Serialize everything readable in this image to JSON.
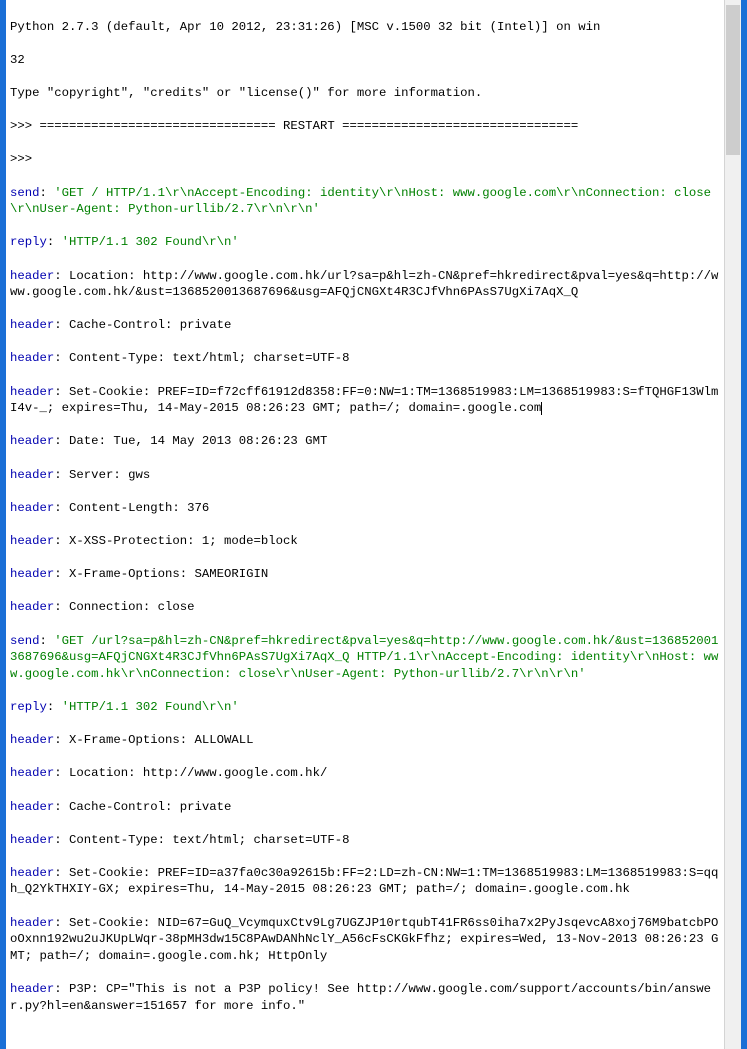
{
  "banner": {
    "line1": "Python 2.7.3 (default, Apr 10 2012, 23:31:26) [MSC v.1500 32 bit (Intel)] on win",
    "line2": "32",
    "typeinfo": "Type \"copyright\", \"credits\" or \"license()\" for more information.",
    "prompt1": ">>> ",
    "restart_bar": "================================ RESTART ================================",
    "prompt2": ">>> "
  },
  "t": {
    "send": "send",
    "reply": "reply",
    "header": "header"
  },
  "req1": {
    "send": "'GET / HTTP/1.1\\r\\nAccept-Encoding: identity\\r\\nHost: www.google.com\\r\\nConnection: close\\r\\nUser-Agent: Python-urllib/2.7\\r\\n\\r\\n'",
    "reply": "'HTTP/1.1 302 Found\\r\\n'",
    "h_location": "Location: http://www.google.com.hk/url?sa=p&hl=zh-CN&pref=hkredirect&pval=yes&q=http://www.google.com.hk/&ust=1368520013687696&usg=AFQjCNGXt4R3CJfVhn6PAsS7UgXi7AqX_Q",
    "h_cache": "Cache-Control: private",
    "h_ctype": "Content-Type: text/html; charset=UTF-8",
    "h_setcookie": "Set-Cookie: PREF=ID=f72cff61912d8358:FF=0:NW=1:TM=1368519983:LM=1368519983:S=fTQHGF13WlmI4v-_; expires=Thu, 14-May-2015 08:26:23 GMT; path=/; domain=.google.com",
    "h_date": "Date: Tue, 14 May 2013 08:26:23 GMT",
    "h_server": "Server: gws",
    "h_clen": "Content-Length: 376",
    "h_xss": "X-XSS-Protection: 1; mode=block",
    "h_xframe": "X-Frame-Options: SAMEORIGIN",
    "h_conn": "Connection: close"
  },
  "req2": {
    "send": "'GET /url?sa=p&hl=zh-CN&pref=hkredirect&pval=yes&q=http://www.google.com.hk/&ust=1368520013687696&usg=AFQjCNGXt4R3CJfVhn6PAsS7UgXi7AqX_Q HTTP/1.1\\r\\nAccept-Encoding: identity\\r\\nHost: www.google.com.hk\\r\\nConnection: close\\r\\nUser-Agent: Python-urllib/2.7\\r\\n\\r\\n'",
    "reply": "'HTTP/1.1 302 Found\\r\\n'",
    "h_xframe": "X-Frame-Options: ALLOWALL",
    "h_location": "Location: http://www.google.com.hk/",
    "h_cache": "Cache-Control: private",
    "h_ctype": "Content-Type: text/html; charset=UTF-8",
    "h_setcookie1": "Set-Cookie: PREF=ID=a37fa0c30a92615b:FF=2:LD=zh-CN:NW=1:TM=1368519983:LM=1368519983:S=qqh_Q2YkTHXIY-GX; expires=Thu, 14-May-2015 08:26:23 GMT; path=/; domain=.google.com.hk",
    "h_setcookie2": "Set-Cookie: NID=67=GuQ_VcymquxCtv9Lg7UGZJP10rtqubT41FR6ss0iha7x2PyJsqevcA8xoj76M9batcbPOoOxnn192wu2uJKUpLWqr-38pMH3dw15C8PAwDANhNclY_A56cFsCKGkFfhz; expires=Wed, 13-Nov-2013 08:26:23 GMT; path=/; domain=.google.com.hk; HttpOnly",
    "h_p3p": "P3P: CP=\"This is not a P3P policy! See http://www.google.com/support/accounts/bin/answer.py?hl=en&answer=151657 for more info.\""
  }
}
